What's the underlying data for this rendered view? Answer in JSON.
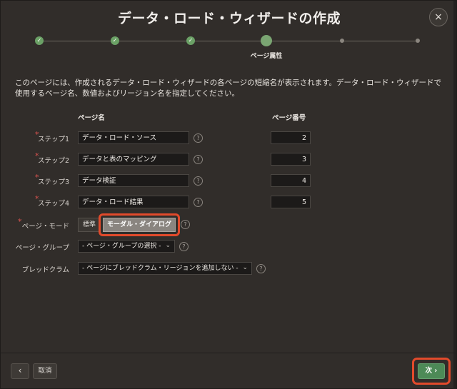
{
  "dialog": {
    "title": "データ・ロード・ウィザードの作成",
    "close_icon": "×"
  },
  "progress": {
    "current_label": "ページ属性",
    "check": "✓"
  },
  "description": "このページには、作成されるデータ・ロード・ウィザードの各ページの短縮名が表示されます。データ・ロード・ウィザードで使用するページ名、数値およびリージョン名を指定してください。",
  "columns": {
    "page_name": "ページ名",
    "page_number": "ページ番号"
  },
  "steps": [
    {
      "label": "ステップ1",
      "name": "データ・ロード・ソース",
      "number": "2"
    },
    {
      "label": "ステップ2",
      "name": "データと表のマッピング",
      "number": "3"
    },
    {
      "label": "ステップ3",
      "name": "データ検証",
      "number": "4"
    },
    {
      "label": "ステップ4",
      "name": "データ・ロード結果",
      "number": "5"
    }
  ],
  "page_mode": {
    "label": "ページ・モード",
    "options": [
      "標準",
      "モーダル・ダイアログ"
    ],
    "selected": "モーダル・ダイアログ"
  },
  "page_group": {
    "label": "ページ・グループ",
    "value": "- ページ・グループの選択 -"
  },
  "breadcrumb": {
    "label": "ブレッドクラム",
    "value": "- ページにブレッドクラム・リージョンを追加しない -"
  },
  "help_icon": "?",
  "footer": {
    "back_icon": "‹",
    "cancel": "取消",
    "next": "次 ›"
  },
  "colors": {
    "accent_green": "#4d8a57",
    "highlight_red": "#e24a2b",
    "required_red": "#d9534f"
  }
}
